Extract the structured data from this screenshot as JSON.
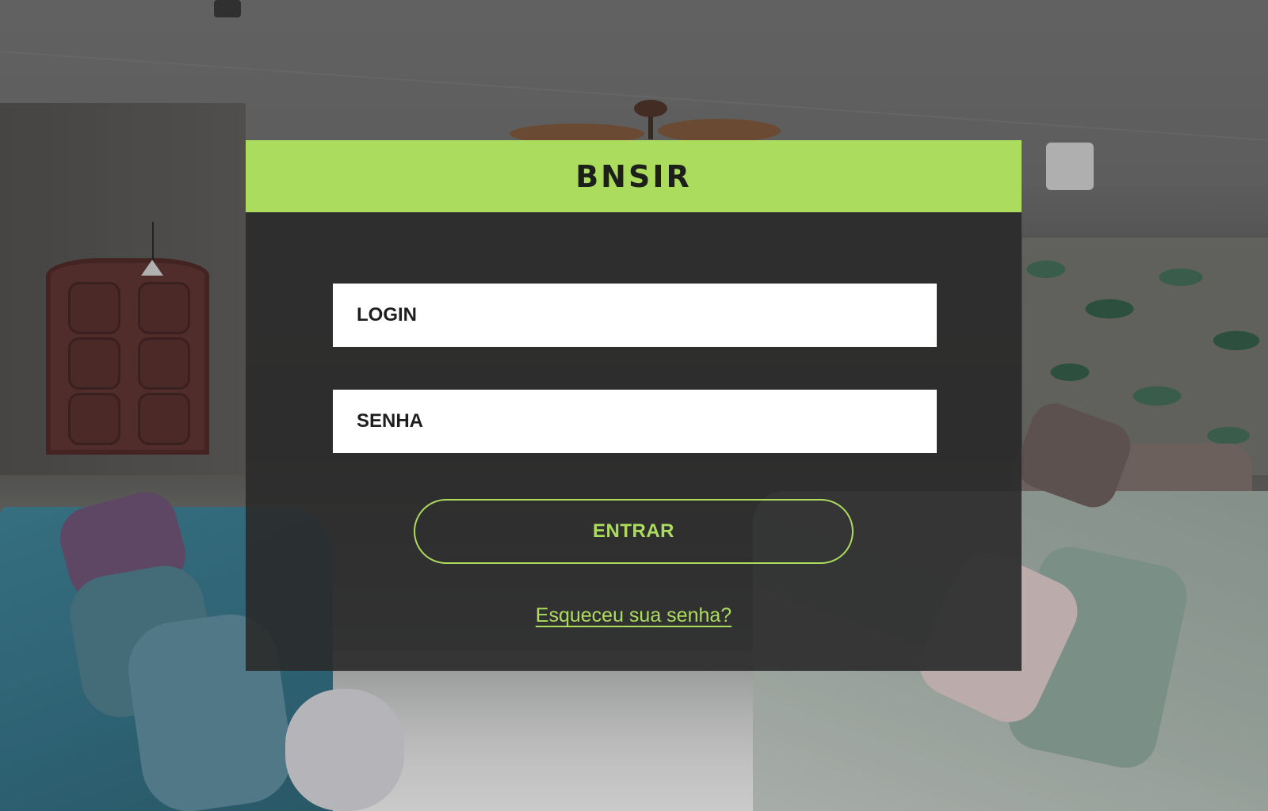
{
  "brand": {
    "name": "BNSIR",
    "header_color": "#acdc5e"
  },
  "form": {
    "login_placeholder": "LOGIN",
    "login_value": "",
    "password_placeholder": "SENHA",
    "password_value": "",
    "submit_label": "ENTRAR",
    "forgot_password_label": "Esqueceu sua senha?"
  },
  "colors": {
    "accent": "#acdc5e",
    "panel_background": "#2a2a2a",
    "field_background": "#ffffff",
    "text_dark": "#1e1e1e"
  }
}
